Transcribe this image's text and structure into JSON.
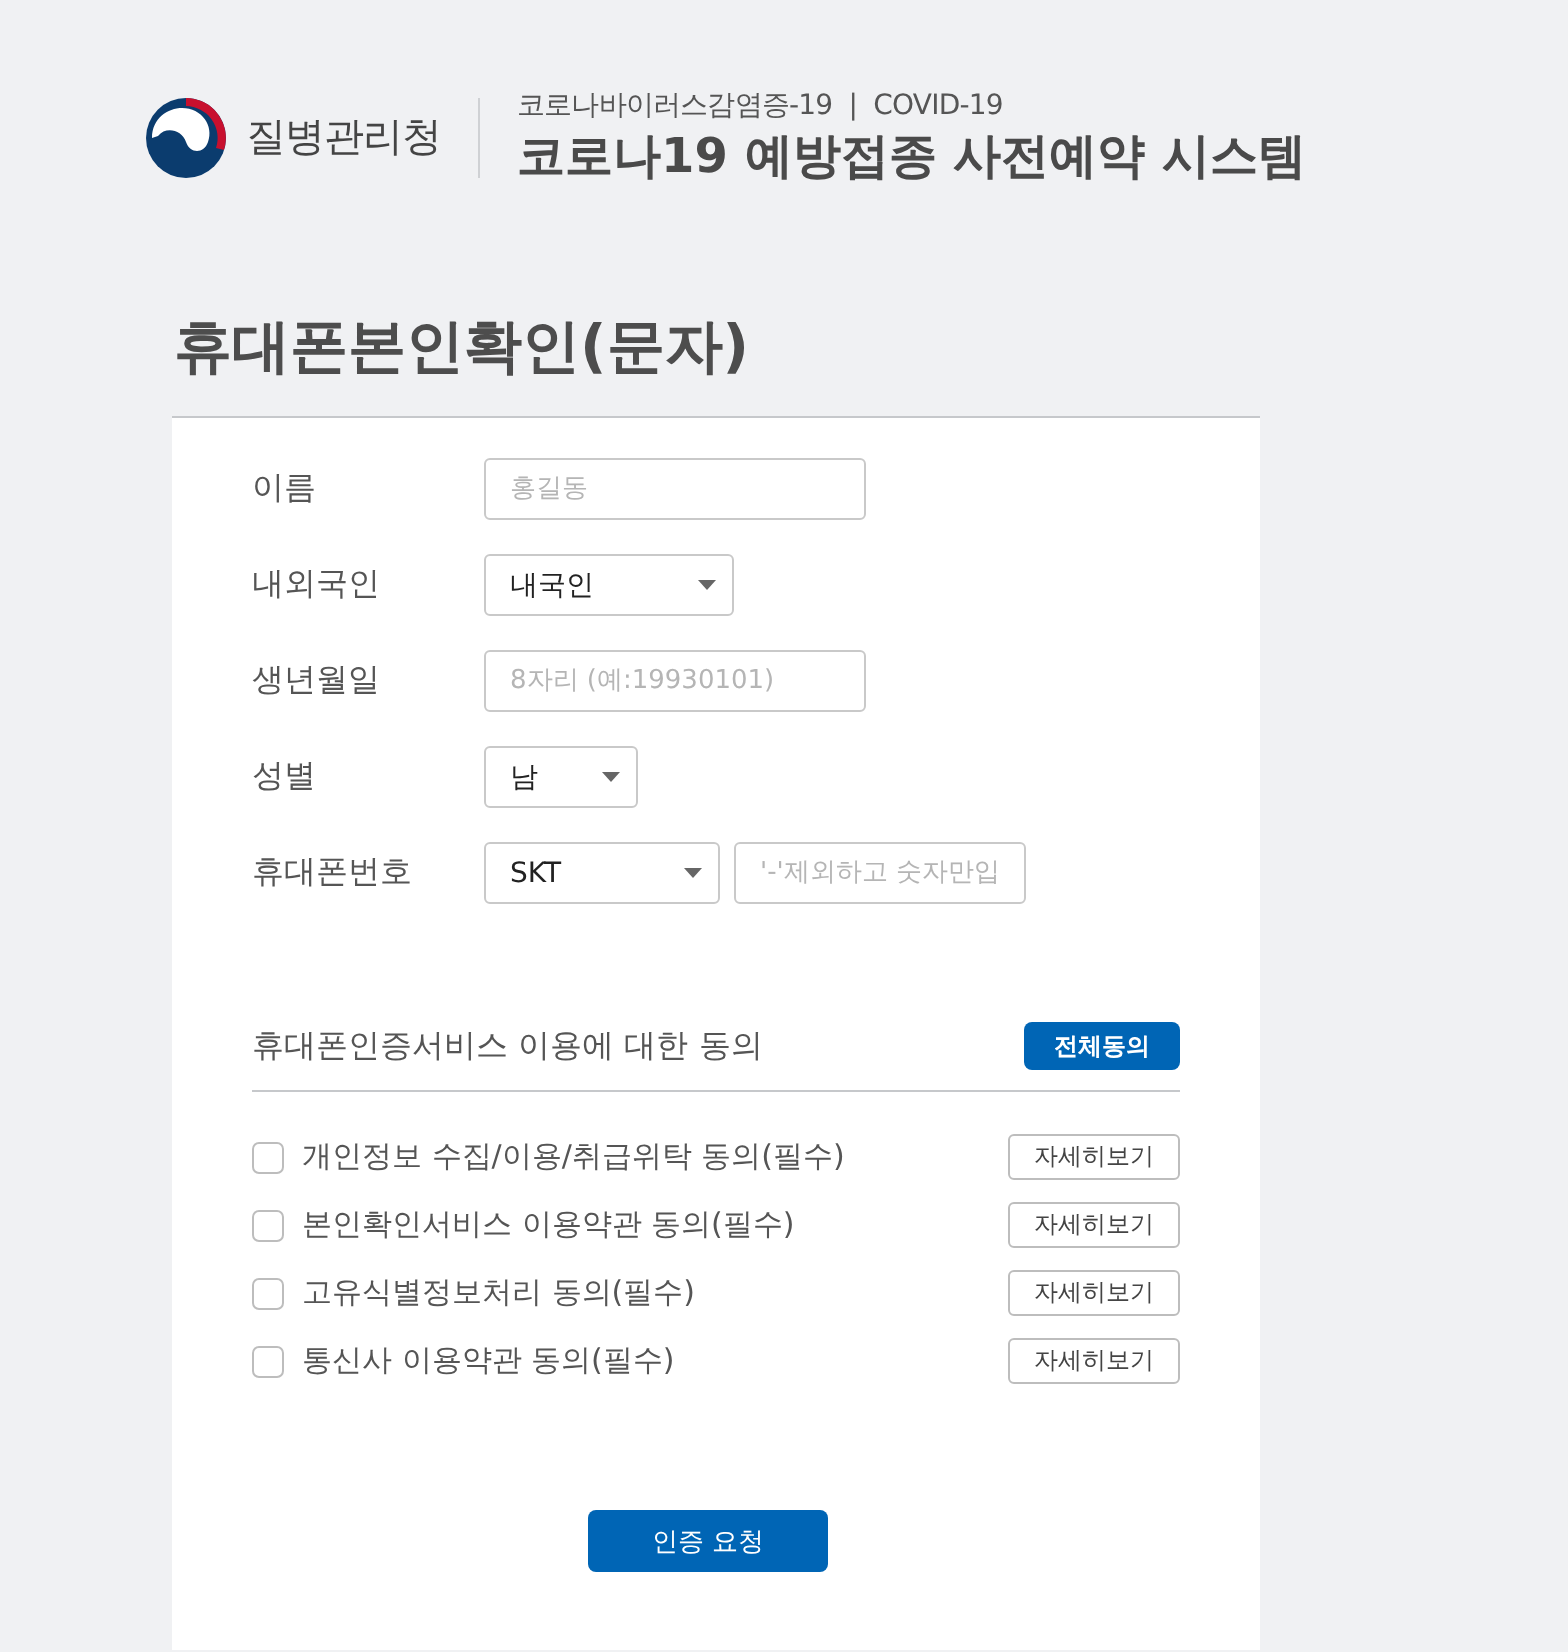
{
  "header": {
    "agency": "질병관리청",
    "subtitle": "코로나바이러스감염증-19  |  COVID-19",
    "title": "코로나19 예방접종 사전예약 시스템"
  },
  "page_title": "휴대폰본인확인(문자)",
  "form": {
    "fields": [
      {
        "label": "이름",
        "controls": [
          {
            "kind": "input",
            "placeholder": "홍길동"
          }
        ]
      },
      {
        "label": "내외국인",
        "controls": [
          {
            "kind": "select",
            "value": "내국인"
          }
        ]
      },
      {
        "label": "생년월일",
        "controls": [
          {
            "kind": "input",
            "placeholder": "8자리 (예:19930101)"
          }
        ]
      },
      {
        "label": "성별",
        "controls": [
          {
            "kind": "select",
            "value": "남"
          }
        ]
      },
      {
        "label": "휴대폰번호",
        "controls": [
          {
            "kind": "select",
            "value": "SKT"
          },
          {
            "kind": "input",
            "placeholder": "'-'제외하고 숫자만입"
          }
        ]
      }
    ]
  },
  "consent": {
    "title": "휴대폰인증서비스 이용에 대한 동의",
    "agree_all_button": "전체동의",
    "items": [
      {
        "label": "개인정보 수집/이용/취급위탁 동의(필수)",
        "checked": false,
        "detail_button": "자세히보기"
      },
      {
        "label": "본인확인서비스 이용약관 동의(필수)",
        "checked": false,
        "detail_button": "자세히보기"
      },
      {
        "label": "고유식별정보처리 동의(필수)",
        "checked": false,
        "detail_button": "자세히보기"
      },
      {
        "label": "통신사 이용약관 동의(필수)",
        "checked": false,
        "detail_button": "자세히보기"
      }
    ]
  },
  "submit_button": "인증 요청"
}
